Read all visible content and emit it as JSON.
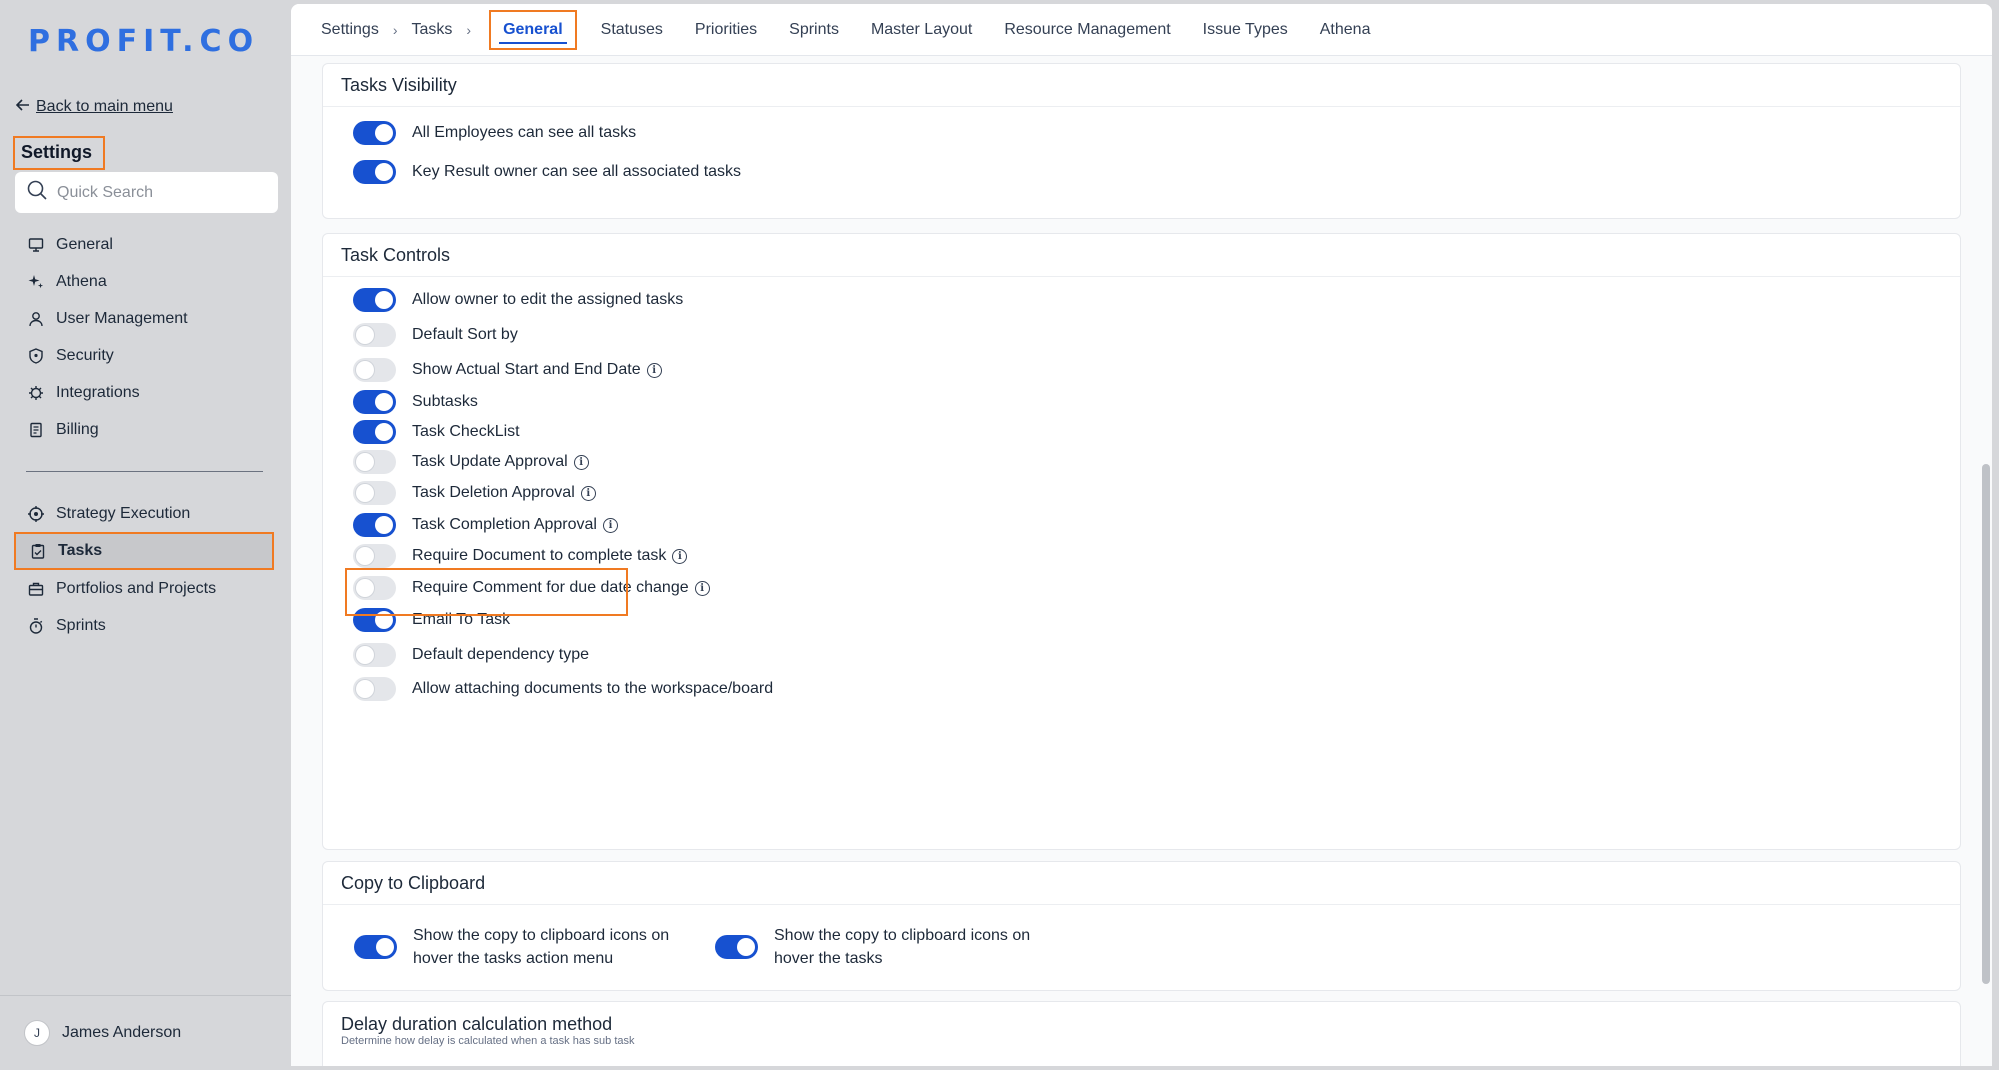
{
  "sidebar": {
    "logo": "PROFIT.CO",
    "back_link": "Back to main menu",
    "title": "Settings",
    "search_placeholder": "Quick Search",
    "items_top": [
      {
        "label": "General",
        "icon": "monitor-icon"
      },
      {
        "label": "Athena",
        "icon": "sparkle-icon"
      },
      {
        "label": "User Management",
        "icon": "user-icon"
      },
      {
        "label": "Security",
        "icon": "shield-icon"
      },
      {
        "label": "Integrations",
        "icon": "gear-icon"
      },
      {
        "label": "Billing",
        "icon": "receipt-icon"
      }
    ],
    "items_bottom": [
      {
        "label": "Strategy Execution",
        "icon": "target-icon"
      },
      {
        "label": "Tasks",
        "icon": "clipboard-check-icon",
        "active": true
      },
      {
        "label": "Portfolios and Projects",
        "icon": "briefcase-icon"
      },
      {
        "label": "Sprints",
        "icon": "stopwatch-icon"
      }
    ],
    "user": {
      "initial": "J",
      "name": "James Anderson"
    }
  },
  "breadcrumb": {
    "root": "Settings",
    "section": "Tasks"
  },
  "tabs": [
    "General",
    "Statuses",
    "Priorities",
    "Sprints",
    "Master Layout",
    "Resource Management",
    "Issue Types",
    "Athena"
  ],
  "active_tab": "General",
  "visibility": {
    "title": "Tasks Visibility",
    "items": [
      {
        "label": "All Employees can see all tasks",
        "on": true
      },
      {
        "label": "Key Result owner can see all associated tasks",
        "on": true
      }
    ]
  },
  "controls": {
    "title": "Task Controls",
    "items": [
      {
        "label": "Allow owner to edit the assigned tasks",
        "on": true,
        "info": false
      },
      {
        "label": "Default Sort by",
        "on": false,
        "info": false
      },
      {
        "label": "Show Actual Start and End Date",
        "on": false,
        "info": true
      },
      {
        "label": "Subtasks",
        "on": true,
        "info": false
      },
      {
        "label": "Task CheckList",
        "on": true,
        "info": false
      },
      {
        "label": "Task Update Approval",
        "on": false,
        "info": true
      },
      {
        "label": "Task Deletion Approval",
        "on": false,
        "info": true
      },
      {
        "label": "Task Completion Approval",
        "on": true,
        "info": true
      },
      {
        "label": "Require Document to complete task",
        "on": false,
        "info": true
      },
      {
        "label": "Require Comment for due date change",
        "on": false,
        "info": true
      },
      {
        "label": "Email To Task",
        "on": true,
        "info": false
      },
      {
        "label": "Default dependency type",
        "on": false,
        "info": false
      },
      {
        "label": "Allow attaching documents to the workspace/board",
        "on": false,
        "info": false
      }
    ]
  },
  "clipboard": {
    "title": "Copy to Clipboard",
    "items": [
      {
        "line1": "Show the copy to clipboard icons on",
        "line2": "hover the tasks action menu",
        "on": true
      },
      {
        "line1": "Show the copy to clipboard icons on",
        "line2": "hover the tasks",
        "on": true
      }
    ]
  },
  "delay": {
    "title": "Delay duration calculation method",
    "subtitle": "Determine how delay is calculated when a task has sub task"
  },
  "colors": {
    "accent": "#1751d0",
    "highlight": "#f07a22",
    "logo": "#2f6fe0"
  }
}
